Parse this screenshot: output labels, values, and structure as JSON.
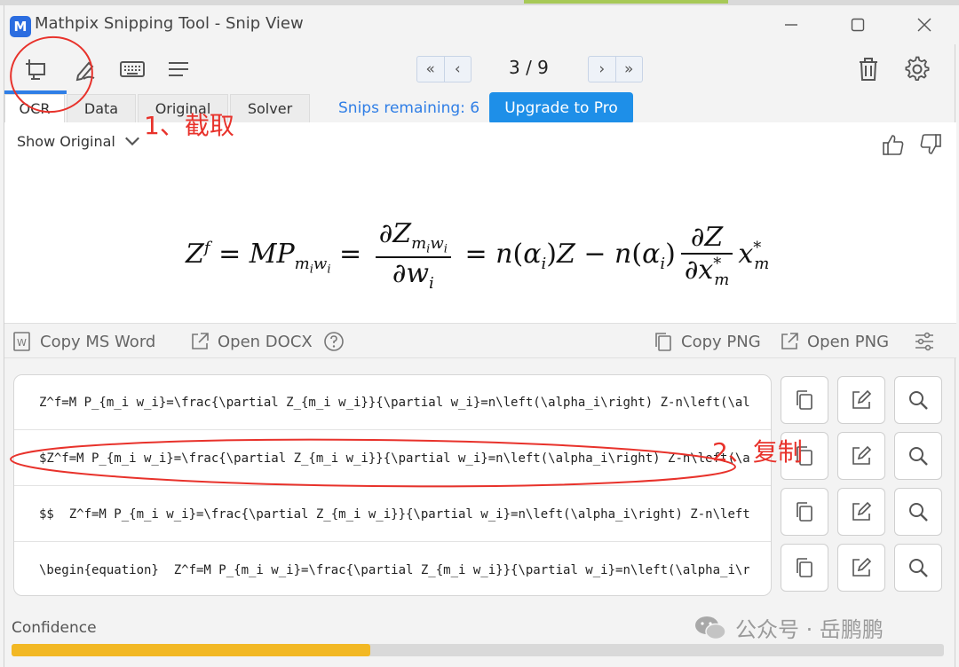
{
  "window": {
    "app_logo": "M",
    "title": "Mathpix Snipping Tool - Snip View",
    "controls": [
      "minimize-icon",
      "maximize-icon",
      "close-icon"
    ]
  },
  "toolbar": {
    "tools": [
      "snip-icon",
      "pen-icon",
      "keyboard-icon",
      "menu-icon"
    ],
    "pager": "3 / 9",
    "right_tools": [
      "trash-icon",
      "gear-icon"
    ]
  },
  "tabs": {
    "items": [
      {
        "label": "OCR",
        "active": true
      },
      {
        "label": "Data",
        "active": false
      },
      {
        "label": "Original",
        "active": false
      },
      {
        "label": "Solver",
        "active": false
      }
    ],
    "snips_remaining": "Snips remaining: 6",
    "upgrade_label": "Upgrade to Pro"
  },
  "preview": {
    "show_original": "Show Original"
  },
  "actions": {
    "copy_ms_word": "Copy MS Word",
    "open_docx": "Open DOCX",
    "copy_png": "Copy PNG",
    "open_png": "Open PNG"
  },
  "results": [
    "Z^f=M P_{m_i w_i}=\\frac{\\partial Z_{m_i w_i}}{\\partial w_i}=n\\left(\\alpha_i\\right) Z-n\\left(\\alpha_i\\right) \\frac{\\partial Z}{\\partial x_m^*} x_m^*",
    "$Z^f=M P_{m_i w_i}=\\frac{\\partial Z_{m_i w_i}}{\\partial w_i}=n\\left(\\alpha_i\\right) Z-n\\left(\\alpha_i\\right) \\frac{\\partial Z}{\\partial x_m^*} x_m^*$",
    "$$  Z^f=M P_{m_i w_i}=\\frac{\\partial Z_{m_i w_i}}{\\partial w_i}=n\\left(\\alpha_i\\right) Z-n\\left(\\alpha_i\\right) \\frac{\\partial Z}{\\partial x_m^*} x_m^*  $$",
    "\\begin{equation}  Z^f=M P_{m_i w_i}=\\frac{\\partial Z_{m_i w_i}}{\\partial w_i}=n\\left(\\alpha_i\\right) Z-n\\left(\\alpha_i\\right) \\frac{\\partial Z}{\\partial x_m^*} x_m^*  \\end{equation}"
  ],
  "confidence": {
    "label": "Confidence",
    "value": 0.385
  },
  "annotations": {
    "step1": "1、截取",
    "step2": "2、复制",
    "color": "#e8322b"
  },
  "watermark": "公众号 · 岳鹏鹏",
  "colors": {
    "accent": "#2f7ee6",
    "upgrade_bg": "#1e8fe8",
    "confidence_fill": "#f2b824"
  }
}
